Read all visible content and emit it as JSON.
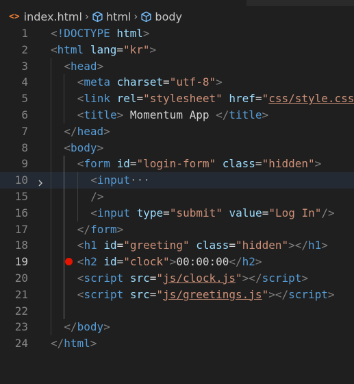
{
  "breadcrumb": {
    "file": "index.html",
    "items": [
      "html",
      "body"
    ],
    "separator": "›"
  },
  "icons": {
    "file": "html-file-icon",
    "element": "symbol-structure-icon",
    "fold": "chevron-right-icon",
    "breakpoint": "breakpoint-icon"
  },
  "editor": {
    "current_line": "19",
    "lines": [
      {
        "num": "1",
        "indent": 0,
        "tokens": [
          [
            "br",
            "<"
          ],
          [
            "tag",
            "!DOCTYPE"
          ],
          [
            "txt",
            " "
          ],
          [
            "attr",
            "html"
          ],
          [
            "br",
            ">"
          ]
        ]
      },
      {
        "num": "2",
        "indent": 0,
        "tokens": [
          [
            "br",
            "<"
          ],
          [
            "tag",
            "html"
          ],
          [
            "txt",
            " "
          ],
          [
            "attr",
            "lang"
          ],
          [
            "txt",
            "="
          ],
          [
            "str",
            "\"kr\""
          ],
          [
            "br",
            ">"
          ]
        ]
      },
      {
        "num": "3",
        "indent": 1,
        "tokens": [
          [
            "br",
            "<"
          ],
          [
            "tag",
            "head"
          ],
          [
            "br",
            ">"
          ]
        ]
      },
      {
        "num": "4",
        "indent": 2,
        "tokens": [
          [
            "br",
            "<"
          ],
          [
            "tag",
            "meta"
          ],
          [
            "txt",
            " "
          ],
          [
            "attr",
            "charset"
          ],
          [
            "txt",
            "="
          ],
          [
            "str",
            "\"utf-8\""
          ],
          [
            "br",
            ">"
          ]
        ]
      },
      {
        "num": "5",
        "indent": 2,
        "tokens": [
          [
            "br",
            "<"
          ],
          [
            "tag",
            "link"
          ],
          [
            "txt",
            " "
          ],
          [
            "attr",
            "rel"
          ],
          [
            "txt",
            "="
          ],
          [
            "str",
            "\"stylesheet\""
          ],
          [
            "txt",
            " "
          ],
          [
            "attr",
            "href"
          ],
          [
            "txt",
            "="
          ],
          [
            "str",
            "\""
          ],
          [
            "link",
            "css/style.css"
          ]
        ]
      },
      {
        "num": "6",
        "indent": 2,
        "tokens": [
          [
            "br",
            "<"
          ],
          [
            "tag",
            "title"
          ],
          [
            "br",
            ">"
          ],
          [
            "txt",
            " Momentum App "
          ],
          [
            "br",
            "</"
          ],
          [
            "tag",
            "title"
          ],
          [
            "br",
            ">"
          ]
        ]
      },
      {
        "num": "7",
        "indent": 1,
        "tokens": [
          [
            "br",
            "</"
          ],
          [
            "tag",
            "head"
          ],
          [
            "br",
            ">"
          ]
        ]
      },
      {
        "num": "8",
        "indent": 1,
        "tokens": [
          [
            "br",
            "<"
          ],
          [
            "tag",
            "body"
          ],
          [
            "br",
            ">"
          ]
        ]
      },
      {
        "num": "9",
        "indent": 2,
        "tokens": [
          [
            "br",
            "<"
          ],
          [
            "tag",
            "form"
          ],
          [
            "txt",
            " "
          ],
          [
            "attr",
            "id"
          ],
          [
            "txt",
            "="
          ],
          [
            "str",
            "\"login-form\""
          ],
          [
            "txt",
            " "
          ],
          [
            "attr",
            "class"
          ],
          [
            "txt",
            "="
          ],
          [
            "str",
            "\"hidden\""
          ],
          [
            "br",
            ">"
          ]
        ]
      },
      {
        "num": "10",
        "indent": 3,
        "tokens": [
          [
            "br",
            "<"
          ],
          [
            "tag",
            "input"
          ],
          [
            "fold",
            "···"
          ]
        ]
      },
      {
        "num": "15",
        "indent": 3,
        "tokens": [
          [
            "br",
            "/>"
          ]
        ]
      },
      {
        "num": "16",
        "indent": 3,
        "tokens": [
          [
            "br",
            "<"
          ],
          [
            "tag",
            "input"
          ],
          [
            "txt",
            " "
          ],
          [
            "attr",
            "type"
          ],
          [
            "txt",
            "="
          ],
          [
            "str",
            "\"submit\""
          ],
          [
            "txt",
            " "
          ],
          [
            "attr",
            "value"
          ],
          [
            "txt",
            "="
          ],
          [
            "str",
            "\"Log In\""
          ],
          [
            "br",
            "/>"
          ]
        ]
      },
      {
        "num": "17",
        "indent": 2,
        "tokens": [
          [
            "br",
            "</"
          ],
          [
            "tag",
            "form"
          ],
          [
            "br",
            ">"
          ]
        ]
      },
      {
        "num": "18",
        "indent": 2,
        "tokens": [
          [
            "br",
            "<"
          ],
          [
            "tag",
            "h1"
          ],
          [
            "txt",
            " "
          ],
          [
            "attr",
            "id"
          ],
          [
            "txt",
            "="
          ],
          [
            "str",
            "\"greeting\""
          ],
          [
            "txt",
            " "
          ],
          [
            "attr",
            "class"
          ],
          [
            "txt",
            "="
          ],
          [
            "str",
            "\"hidden\""
          ],
          [
            "br",
            "></"
          ],
          [
            "tag",
            "h1"
          ],
          [
            "br",
            ">"
          ]
        ]
      },
      {
        "num": "19",
        "indent": 2,
        "tokens": [
          [
            "br",
            "<"
          ],
          [
            "tag",
            "h2"
          ],
          [
            "txt",
            " "
          ],
          [
            "attr",
            "id"
          ],
          [
            "txt",
            "="
          ],
          [
            "str",
            "\"clock\""
          ],
          [
            "br",
            ">"
          ],
          [
            "txt",
            "00:00:00"
          ],
          [
            "br",
            "</"
          ],
          [
            "tag",
            "h2"
          ],
          [
            "br",
            ">"
          ]
        ]
      },
      {
        "num": "20",
        "indent": 2,
        "tokens": [
          [
            "br",
            "<"
          ],
          [
            "tag",
            "script"
          ],
          [
            "txt",
            " "
          ],
          [
            "attr",
            "src"
          ],
          [
            "txt",
            "="
          ],
          [
            "str",
            "\""
          ],
          [
            "link",
            "js/clock.js"
          ],
          [
            "str",
            "\""
          ],
          [
            "br",
            "></"
          ],
          [
            "tag",
            "script"
          ],
          [
            "br",
            ">"
          ]
        ]
      },
      {
        "num": "21",
        "indent": 2,
        "tokens": [
          [
            "br",
            "<"
          ],
          [
            "tag",
            "script"
          ],
          [
            "txt",
            " "
          ],
          [
            "attr",
            "src"
          ],
          [
            "txt",
            "="
          ],
          [
            "str",
            "\""
          ],
          [
            "link",
            "js/greetings.js"
          ],
          [
            "str",
            "\""
          ],
          [
            "br",
            "></"
          ],
          [
            "tag",
            "script"
          ],
          [
            "br",
            ">"
          ]
        ]
      },
      {
        "num": "22",
        "indent": 2,
        "tokens": []
      },
      {
        "num": "23",
        "indent": 1,
        "tokens": [
          [
            "br",
            "</"
          ],
          [
            "tag",
            "body"
          ],
          [
            "br",
            ">"
          ]
        ]
      },
      {
        "num": "24",
        "indent": 0,
        "tokens": [
          [
            "br",
            "</"
          ],
          [
            "tag",
            "html"
          ],
          [
            "br",
            ">"
          ]
        ]
      }
    ]
  }
}
